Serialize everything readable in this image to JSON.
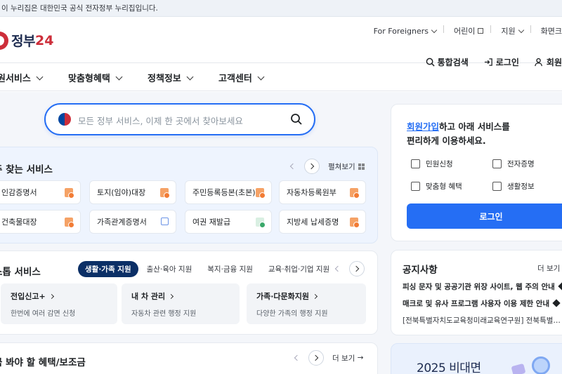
{
  "topbar": {
    "notice": "이 누리집은 대한민국 공식 전자정부 누리집입니다."
  },
  "header": {
    "logo_text": "정부",
    "logo_num": "24",
    "util": [
      "For Foreigners",
      "어린이",
      "지원",
      "화면크"
    ],
    "actions": [
      "통합검색",
      "로그인",
      "회원"
    ]
  },
  "gnb": [
    "원서비스",
    "맞춤형혜택",
    "정책정보",
    "고객센터"
  ],
  "search": {
    "placeholder": "모든 정부 서비스, 이제 한 곳에서 찾아보세요"
  },
  "frequent": {
    "title": "주 찾는 서비스",
    "spread": "펼쳐보기",
    "services": [
      "인감증명서",
      "토지(임야)대장",
      "주민등록등본(초본)",
      "자동차등록원부",
      "건축물대장",
      "가족관계증명서",
      "여권 재발급",
      "지방세 납세증명"
    ]
  },
  "life": {
    "title": "스톱 서비스",
    "tabs": [
      "생활·가족 지원",
      "출산·육아 지원",
      "복지·금융 지원",
      "교육·취업·기업 지원"
    ],
    "boxes": [
      {
        "title": "전입신고+",
        "desc": "한번에 여러 감면 신청"
      },
      {
        "title": "내 차 관리",
        "desc": "자동차 관련 행정 지원"
      },
      {
        "title": "가족·다문화지원",
        "desc": "다양한 가족의 행정 지원"
      }
    ]
  },
  "benefit": {
    "title": "금 봐야 할 혜택/보조금",
    "more": "더 보기"
  },
  "login_panel": {
    "link": "회원가입",
    "msg1": "하고 아래 서비스를",
    "msg2": "편리하게 이용하세요.",
    "quick": [
      "민원신청",
      "전자증명",
      "맞춤형 혜택",
      "생활정보"
    ],
    "button": "로그인"
  },
  "notice": {
    "title": "공지사항",
    "more": "더 보기",
    "items": [
      "피싱 문자 및 공공기관 위장 사이트, 웹 주의 안내",
      "매크로 및 유사 프로그램 사용자 이용 제한 안내",
      "[전북특별자치도교육청미래교육연구원] 전북특별…"
    ]
  },
  "banner": {
    "text": "2025 비대면"
  }
}
